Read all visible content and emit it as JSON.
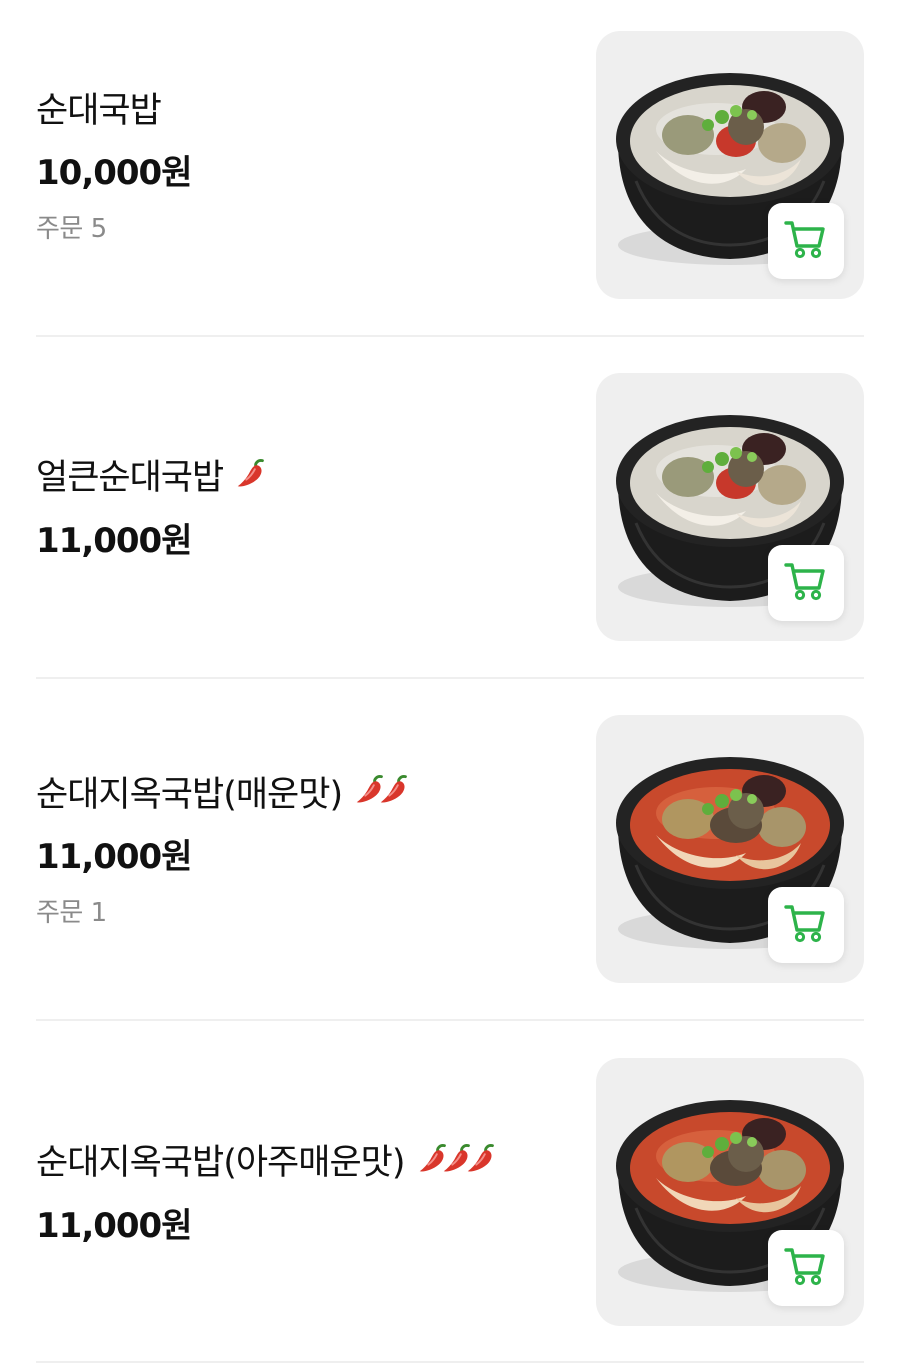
{
  "colors": {
    "accent_green": "#2db34a",
    "pepper_red": "#d9362b",
    "divider": "#efefef",
    "muted_text": "#8a8a8a"
  },
  "menu": [
    {
      "name": "순대국밥",
      "price": "10,000원",
      "orders": "주문 5",
      "spice_level": 0,
      "broth": "white",
      "cart_icon": "cart-icon"
    },
    {
      "name": "얼큰순대국밥",
      "price": "11,000원",
      "orders": "",
      "spice_level": 1,
      "broth": "white",
      "cart_icon": "cart-icon"
    },
    {
      "name": "순대지옥국밥(매운맛)",
      "price": "11,000원",
      "orders": "주문 1",
      "spice_level": 2,
      "broth": "red",
      "cart_icon": "cart-icon"
    },
    {
      "name": "순대지옥국밥(아주매운맛)",
      "price": "11,000원",
      "orders": "",
      "spice_level": 3,
      "broth": "red",
      "cart_icon": "cart-icon"
    }
  ]
}
